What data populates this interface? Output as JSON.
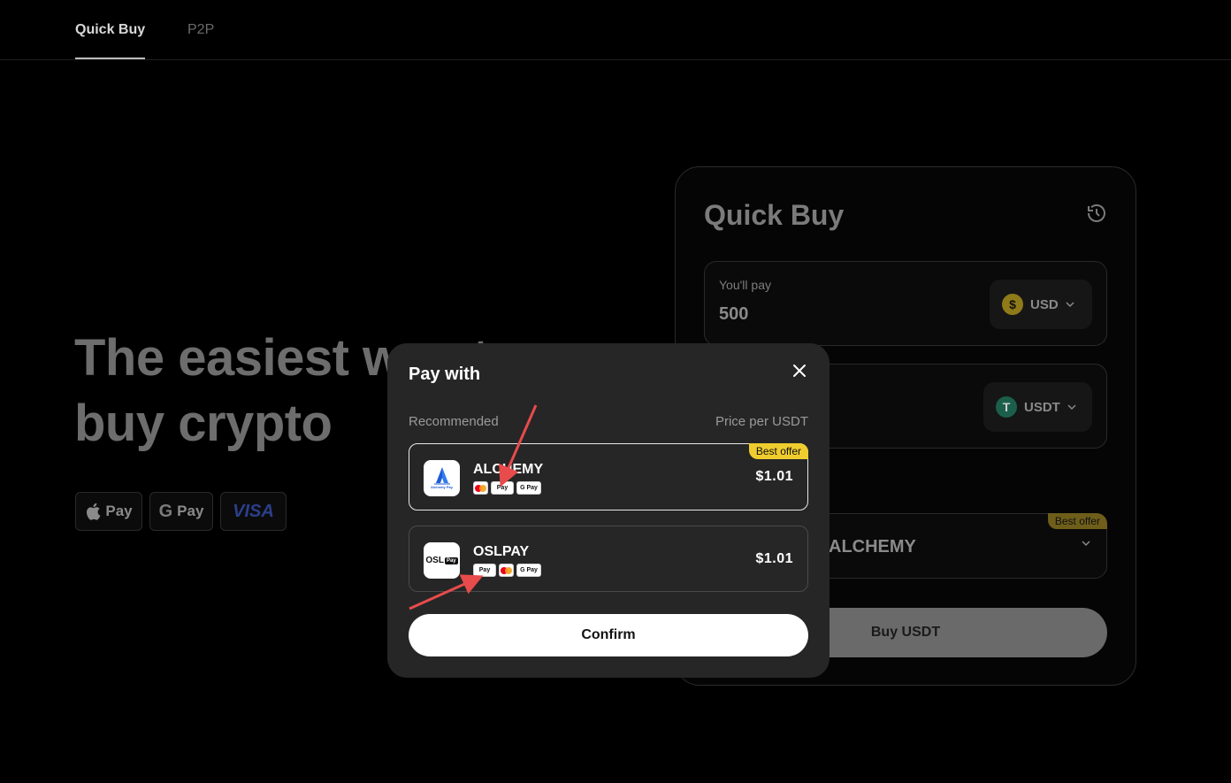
{
  "nav": {
    "tabs": [
      {
        "label": "Quick Buy",
        "active": true
      },
      {
        "label": "P2P",
        "active": false
      }
    ]
  },
  "hero": {
    "line1": "The easiest way to",
    "line2": "buy crypto"
  },
  "payment_badges": [
    {
      "icon": "apple-icon",
      "label": "Pay"
    },
    {
      "icon": "google-g-icon",
      "label": "Pay"
    },
    {
      "icon": "visa-logo",
      "label": "VISA"
    }
  ],
  "quick_buy": {
    "title": "Quick Buy",
    "pay_label": "You'll pay",
    "pay_value": "500",
    "pay_currency": "USD",
    "receive_currency": "USDT",
    "provider_name": "ALCHEMY",
    "provider_badge": "Best offer",
    "buy_label": "Buy USDT"
  },
  "modal": {
    "title": "Pay with",
    "col_left": "Recommended",
    "col_right": "Price per USDT",
    "options": [
      {
        "name": "ALCHEMY",
        "price": "$1.01",
        "badge": "Best offer",
        "methods": [
          "mastercard-visa",
          "apple-pay",
          "google-pay"
        ],
        "selected": true,
        "logo_text": "Alchemy Pay"
      },
      {
        "name": "OSLPAY",
        "price": "$1.01",
        "badge": "",
        "methods": [
          "apple-pay",
          "mastercard",
          "google-pay"
        ],
        "selected": false,
        "logo_text": "OSL"
      }
    ],
    "confirm_label": "Confirm"
  },
  "colors": {
    "accent_yellow": "#f0cd2e",
    "modal_bg": "#262626",
    "annotation_red": "#e84b4b"
  }
}
